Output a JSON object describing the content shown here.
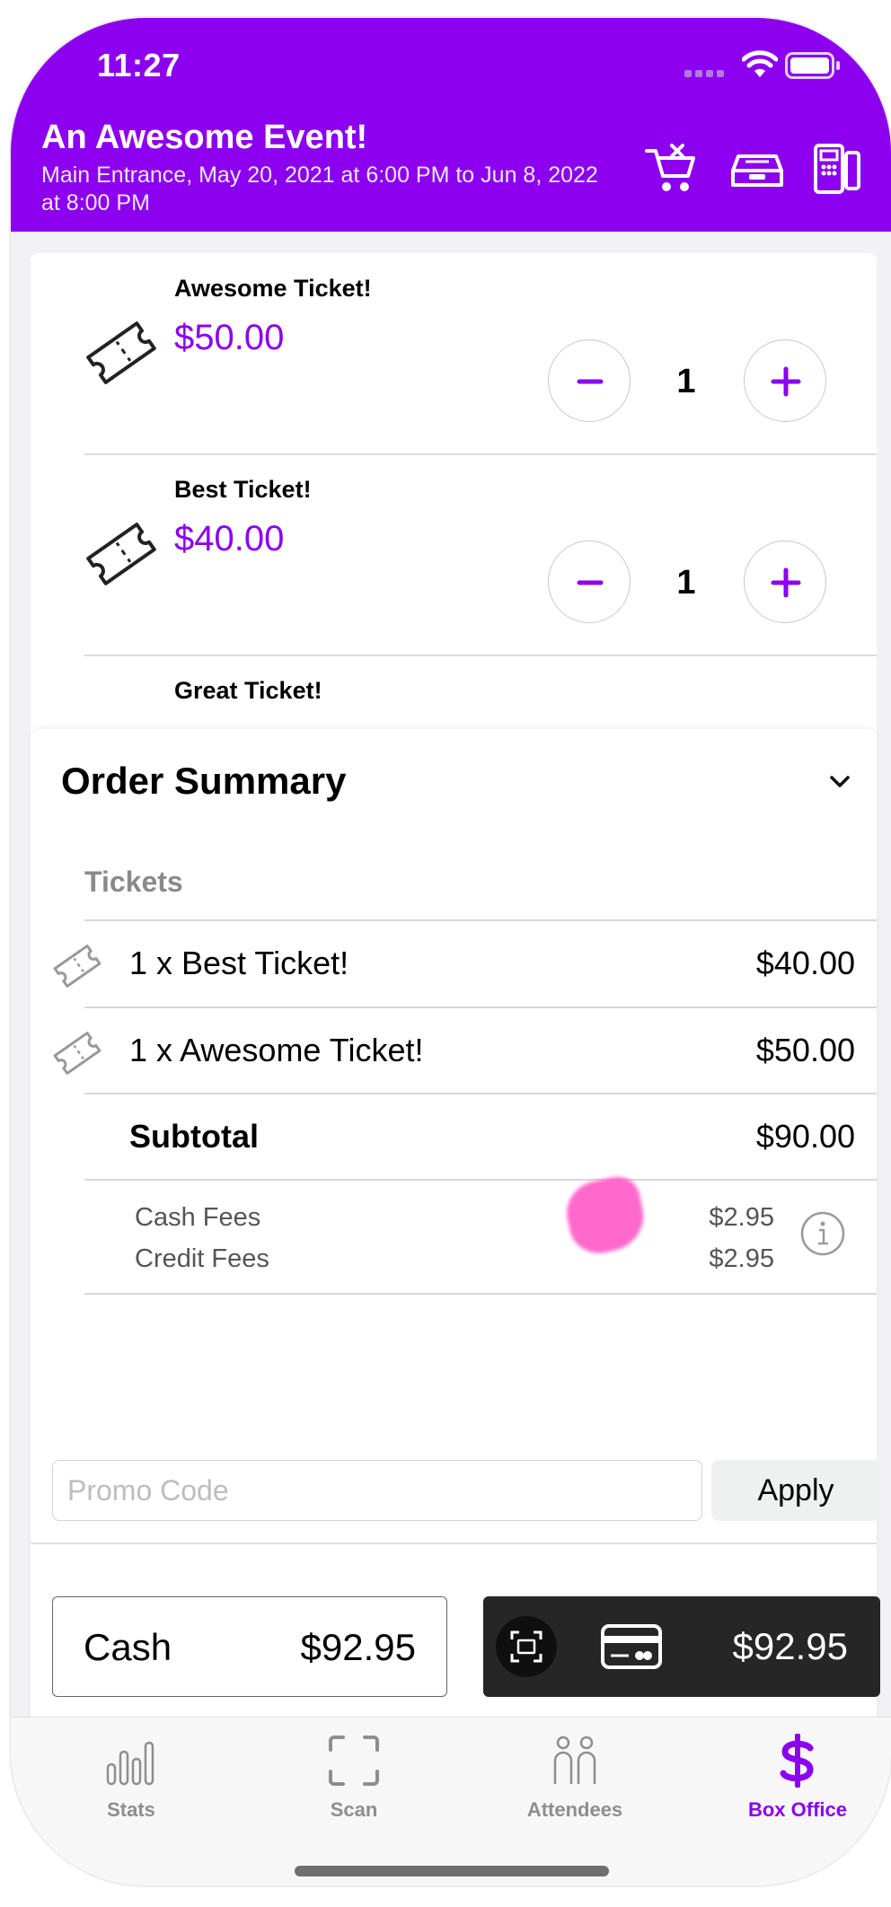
{
  "status_bar": {
    "time": "11:27"
  },
  "colors": {
    "brand": "#8c00ef",
    "dark_button": "#262626",
    "muted": "#8e8e8e"
  },
  "header": {
    "title": "An Awesome Event!",
    "subtitle": "Main Entrance, May 20, 2021 at 6:00 PM to Jun 8, 2022 at 8:00 PM",
    "icons": [
      "clear-cart-icon",
      "cash-drawer-icon",
      "card-reader-icon"
    ]
  },
  "tickets": [
    {
      "name": "Awesome Ticket!",
      "price": "$50.00",
      "qty": "1"
    },
    {
      "name": "Best Ticket!",
      "price": "$40.00",
      "qty": "1"
    },
    {
      "name": "Great Ticket!"
    }
  ],
  "summary": {
    "title": "Order Summary",
    "section_label": "Tickets",
    "items": [
      {
        "label": "1 x Best Ticket!",
        "value": "$40.00"
      },
      {
        "label": "1 x Awesome Ticket!",
        "value": "$50.00"
      }
    ],
    "subtotal": {
      "label": "Subtotal",
      "value": "$90.00"
    },
    "fees": [
      {
        "label": "Cash Fees",
        "value": "$2.95"
      },
      {
        "label": "Credit Fees",
        "value": "$2.95"
      }
    ],
    "promo": {
      "placeholder": "Promo Code",
      "apply_label": "Apply"
    },
    "cash": {
      "label": "Cash",
      "amount": "$92.95"
    },
    "card": {
      "amount": "$92.95"
    }
  },
  "tabbar": {
    "tabs": [
      {
        "label": "Stats",
        "icon": "stats-icon"
      },
      {
        "label": "Scan",
        "icon": "scan-icon"
      },
      {
        "label": "Attendees",
        "icon": "attendees-icon"
      },
      {
        "label": "Box Office",
        "icon": "dollar-icon",
        "active": true
      }
    ]
  }
}
